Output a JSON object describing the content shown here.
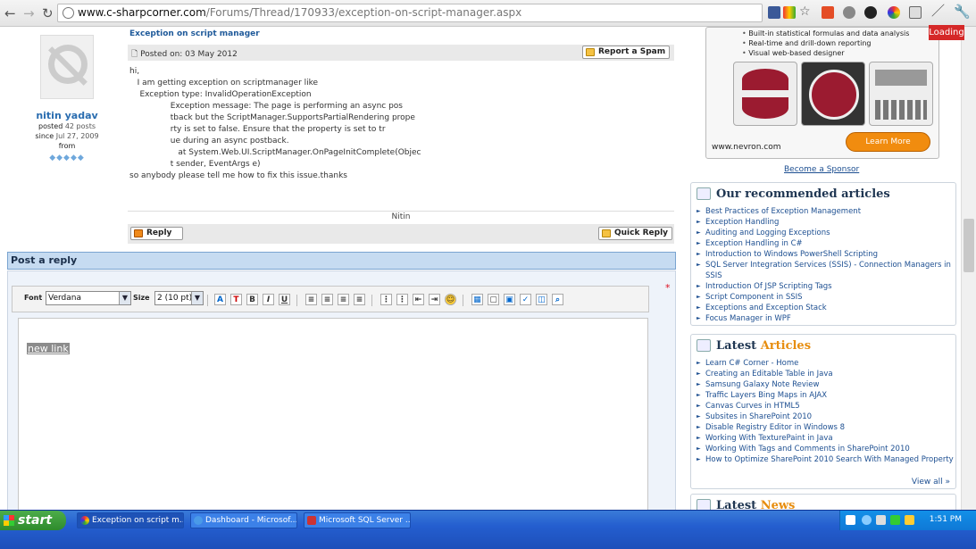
{
  "browser": {
    "url_host": "www.c-sharpcorner.com",
    "url_path": "/Forums/Thread/170933/exception-on-script-manager.aspx",
    "loading_label": "Loading"
  },
  "author": {
    "name": "nitin yadav",
    "posted_label": "posted",
    "posts": "42 posts",
    "since_label": "since",
    "since_date": "Jul 27, 2009",
    "from_label": "from"
  },
  "post": {
    "title": "Exception on script manager",
    "posted_on": "Posted on: 03 May 2012",
    "report_spam": "Report a Spam",
    "body_lines": [
      "hi,",
      "",
      "   I am getting exception on scriptmanager like",
      "",
      "    Exception type: InvalidOperationException",
      "                Exception message: The page is performing an async pos",
      "                tback but the ScriptManager.SupportsPartialRendering prope",
      "                rty is set to false. Ensure that the property is set to tr",
      "                ue during an async postback.",
      "                   at System.Web.UI.ScriptManager.OnPageInitComplete(Objec",
      "                t sender, EventArgs e)",
      "",
      "so anybody please tell me how to fix this issue.thanks"
    ],
    "signature": "Nitin",
    "reply_label": "Reply",
    "quick_reply_label": "Quick Reply"
  },
  "reply": {
    "title": "Post a reply",
    "required_mark": "*",
    "font_label": "Font",
    "font_value": "Verdana",
    "size_label": "Size",
    "size_value": "2 (10 pt)",
    "editor_content": "new link"
  },
  "sidebar": {
    "ad": {
      "bullets": [
        "Built-in statistical formulas and data analysis",
        "Real-time and drill-down reporting",
        "Visual web-based designer"
      ],
      "domain": "www.nevron.com",
      "button": "Learn More"
    },
    "become_sponsor": "Become a Sponsor",
    "recommended": {
      "title": "Our recommended articles",
      "items": [
        "Best Practices of Exception Management",
        "Exception Handling",
        "Auditing and Logging Exceptions",
        "Exception Handling in C#",
        "Introduction to Windows PowerShell Scripting",
        "SQL Server Integration Services (SSIS) - Connection Managers in SSIS",
        "Introduction Of JSP Scripting Tags",
        "Script Component in SSIS",
        "Exceptions and Exception Stack",
        "Focus Manager in WPF"
      ]
    },
    "latest_articles": {
      "title_a": "Latest",
      "title_b": "Articles",
      "items": [
        "Learn C# Corner - Home",
        "Creating an Editable Table in Java",
        "Samsung Galaxy Note Review",
        "Traffic Layers Bing Maps in AJAX",
        "Canvas Curves in HTML5",
        "Subsites in SharePoint 2010",
        "Disable Registry Editor in Windows 8",
        "Working With TexturePaint in Java",
        "Working With Tags and Comments in SharePoint 2010",
        "How to Optimize SharePoint 2010 Search With Managed Property"
      ],
      "view_all": "View all »"
    },
    "latest_news": {
      "title_a": "Latest",
      "title_b": "News"
    }
  },
  "taskbar": {
    "start": "start",
    "tasks": [
      "Exception on script m...",
      "Dashboard - Microsof...",
      "Microsoft SQL Server ..."
    ],
    "clock": "1:51 PM"
  }
}
